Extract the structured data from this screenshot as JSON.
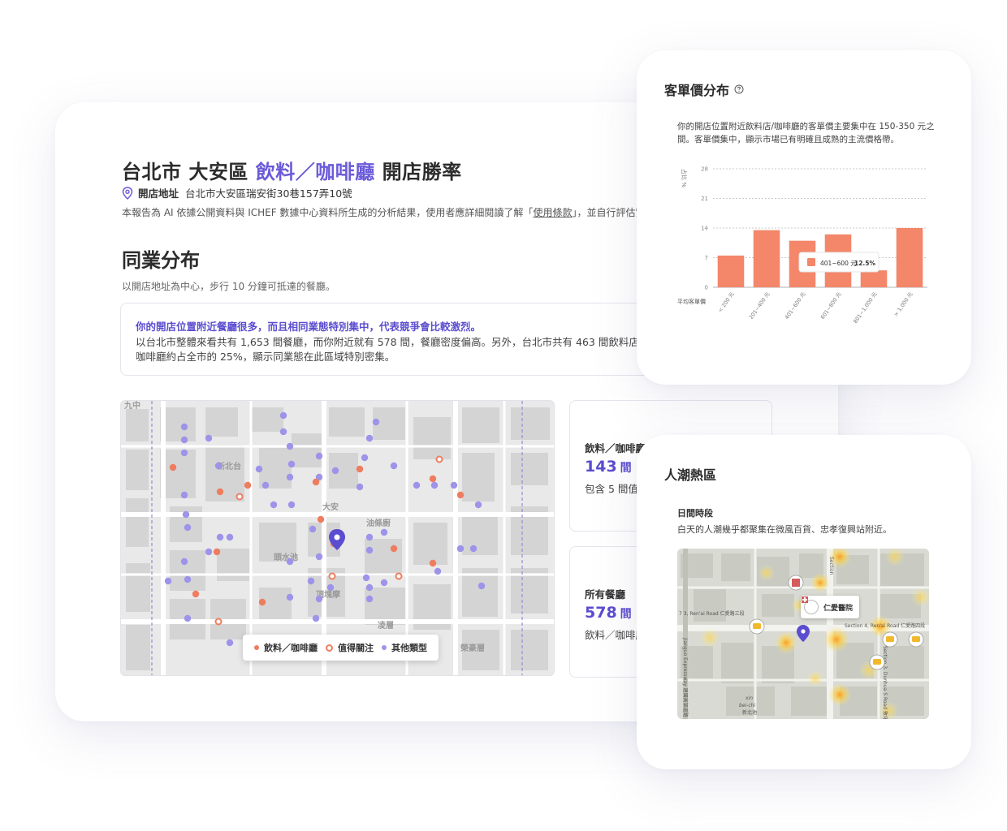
{
  "report": {
    "title_prefix": "台北市 大安區",
    "title_accent": "飲料／咖啡廳",
    "title_suffix": "開店勝率",
    "address_label": "開店地址",
    "address": "台北市大安區瑞安街30巷157弄10號",
    "disclaimer_a": "本報告為 AI 依據公開資料與 ICHEF 數據中心資料所生成的分析結果，使用者應詳細閱讀了解「",
    "disclaimer_terms": "使用條款",
    "disclaimer_b": "」，並自行評估實際"
  },
  "distribution": {
    "title": "同業分布",
    "subtitle": "以開店地址為中心，步行 10 分鐘可抵達的餐廳。",
    "insight_highlight": "你的開店位置附近餐廳很多，而且相同業態特別集中，代表競爭會比較激烈。",
    "insight_body": "以台北市整體來看共有 1,653 間餐廳，而你附近就有 578 間，餐廳密度偏高。另外，台北市共有 463 間飲料店／咖啡廳約占全市的 25%，顯示同業態在此區域特別密集。",
    "legend": {
      "drink": "飲料／咖啡廳",
      "featured": "值得關注",
      "other": "其他類型"
    },
    "map_labels": {
      "a": "九中",
      "b": "新北台",
      "c": "大安",
      "d": "油條廚",
      "e": "頭水池",
      "f": "頂塊摩",
      "g": "凌層",
      "h": "榮豪層",
      "i": "建國高架道路"
    }
  },
  "stats": {
    "drink": {
      "label": "飲料／咖啡廳",
      "value": "143",
      "unit": "間",
      "note": "包含 5 間值得關注"
    },
    "all": {
      "label": "所有餐廳",
      "value": "578",
      "unit": "間",
      "note": "飲料／咖啡廳占"
    }
  },
  "price_card": {
    "title": "客單價分布",
    "desc": "你的開店位置附近飲料店/咖啡廳的客單價主要集中在 150-350 元之間。客單價集中，顯示市場已有明確且成熟的主流價格帶。",
    "ylabel": "占比 %",
    "xlabel": "平均客單價",
    "tooltip_label": "401~600 元",
    "tooltip_value": "12.5%",
    "bar_color": "#f4866a"
  },
  "chart_data": {
    "type": "bar",
    "categories": [
      "< 200 元",
      "201~400 元",
      "401~600 元",
      "601~800 元",
      "801~1,000 元",
      "> 1,000 元"
    ],
    "values": [
      7.5,
      13.5,
      11,
      12.5,
      4,
      14
    ],
    "ylabel": "占比 %",
    "xlabel": "平均客單價",
    "ylim": [
      0,
      28
    ],
    "yticks": [
      0,
      7,
      14,
      21,
      28
    ],
    "grid": true
  },
  "crowd_card": {
    "title": "人潮熱區",
    "sub": "日間時段",
    "desc": "白天的人潮幾乎都聚集在微風百貨、忠孝復興站附近。",
    "map_labels": {
      "hospital": "仁愛醫院",
      "road_left": "7 3, Ren'ai Road 仁愛路三段",
      "road_right": "Section 4, Ren'ai Road 仁愛路四段",
      "expressway": "Jianguo Expressway 建國高架道路",
      "district_a": "xin",
      "district_b": "bei-chi",
      "district_c": "新北池",
      "vertical_a": "Section",
      "vertical_b": "Section 3, Dunhua S Road 敦化南路"
    }
  }
}
